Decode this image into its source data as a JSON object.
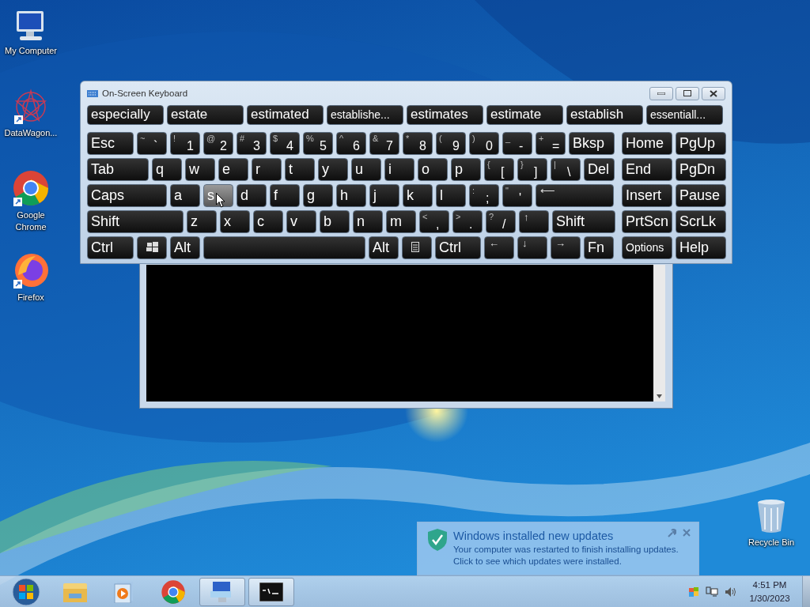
{
  "desktop_icons": [
    {
      "kind": "computer",
      "label": "My Computer"
    },
    {
      "kind": "datawagon",
      "label": "DataWagon..."
    },
    {
      "kind": "chrome",
      "label": "Google Chrome"
    },
    {
      "kind": "firefox",
      "label": "Firefox"
    },
    {
      "kind": "recycle",
      "label": "Recycle Bin"
    }
  ],
  "keyboard": {
    "title": "On-Screen Keyboard",
    "suggestions": [
      "especially",
      "estate",
      "estimated",
      "establishe...",
      "estimates",
      "estimate",
      "establish",
      "essentiall..."
    ],
    "rows": [
      {
        "keys": [
          {
            "kind": "word",
            "label": "Esc",
            "highlighted": false
          },
          {
            "kind": "char",
            "shift": "~",
            "main": "`",
            "highlighted": false
          },
          {
            "kind": "char",
            "shift": "!",
            "main": "1",
            "highlighted": false
          },
          {
            "kind": "char",
            "shift": "@",
            "main": "2",
            "highlighted": false
          },
          {
            "kind": "char",
            "shift": "#",
            "main": "3",
            "highlighted": false
          },
          {
            "kind": "char",
            "shift": "$",
            "main": "4",
            "highlighted": false
          },
          {
            "kind": "char",
            "shift": "%",
            "main": "5",
            "highlighted": false
          },
          {
            "kind": "char",
            "shift": "^",
            "main": "6",
            "highlighted": false
          },
          {
            "kind": "char",
            "shift": "&",
            "main": "7",
            "highlighted": false
          },
          {
            "kind": "char",
            "shift": "*",
            "main": "8",
            "highlighted": false
          },
          {
            "kind": "char",
            "shift": "(",
            "main": "9",
            "highlighted": false
          },
          {
            "kind": "char",
            "shift": ")",
            "main": "0",
            "highlighted": false
          },
          {
            "kind": "char",
            "shift": "_",
            "main": "-",
            "highlighted": false
          },
          {
            "kind": "char",
            "shift": "+",
            "main": "=",
            "highlighted": false
          },
          {
            "kind": "word",
            "label": "Bksp",
            "highlighted": false
          }
        ]
      },
      {
        "keys": [
          {
            "kind": "word",
            "label": "Tab",
            "highlighted": false
          },
          {
            "kind": "word",
            "label": "q",
            "highlighted": false
          },
          {
            "kind": "word",
            "label": "w",
            "highlighted": false
          },
          {
            "kind": "word",
            "label": "e",
            "highlighted": false
          },
          {
            "kind": "word",
            "label": "r",
            "highlighted": false
          },
          {
            "kind": "word",
            "label": "t",
            "highlighted": false
          },
          {
            "kind": "word",
            "label": "y",
            "highlighted": false
          },
          {
            "kind": "word",
            "label": "u",
            "highlighted": false
          },
          {
            "kind": "word",
            "label": "i",
            "highlighted": false
          },
          {
            "kind": "word",
            "label": "o",
            "highlighted": false
          },
          {
            "kind": "word",
            "label": "p",
            "highlighted": false
          },
          {
            "kind": "char",
            "shift": "{",
            "main": "[",
            "highlighted": false
          },
          {
            "kind": "char",
            "shift": "}",
            "main": "]",
            "highlighted": false
          },
          {
            "kind": "char",
            "shift": "|",
            "main": "\\",
            "highlighted": false
          },
          {
            "kind": "word",
            "label": "Del",
            "highlighted": false
          }
        ]
      },
      {
        "keys": [
          {
            "kind": "word",
            "label": "Caps",
            "highlighted": false
          },
          {
            "kind": "word",
            "label": "a",
            "highlighted": false
          },
          {
            "kind": "word",
            "label": "s",
            "highlighted": true
          },
          {
            "kind": "word",
            "label": "d",
            "highlighted": false
          },
          {
            "kind": "word",
            "label": "f",
            "highlighted": false
          },
          {
            "kind": "word",
            "label": "g",
            "highlighted": false
          },
          {
            "kind": "word",
            "label": "h",
            "highlighted": false
          },
          {
            "kind": "word",
            "label": "j",
            "highlighted": false
          },
          {
            "kind": "word",
            "label": "k",
            "highlighted": false
          },
          {
            "kind": "word",
            "label": "l",
            "highlighted": false
          },
          {
            "kind": "char",
            "shift": ":",
            "main": ";",
            "highlighted": false
          },
          {
            "kind": "char",
            "shift": "\"",
            "main": "'",
            "highlighted": false
          },
          {
            "kind": "arrow",
            "label": "⟵",
            "highlighted": false
          }
        ]
      },
      {
        "keys": [
          {
            "kind": "word",
            "label": "Shift",
            "highlighted": false
          },
          {
            "kind": "word",
            "label": "z",
            "highlighted": false
          },
          {
            "kind": "word",
            "label": "x",
            "highlighted": false
          },
          {
            "kind": "word",
            "label": "c",
            "highlighted": false
          },
          {
            "kind": "word",
            "label": "v",
            "highlighted": false
          },
          {
            "kind": "word",
            "label": "b",
            "highlighted": false
          },
          {
            "kind": "word",
            "label": "n",
            "highlighted": false
          },
          {
            "kind": "word",
            "label": "m",
            "highlighted": false
          },
          {
            "kind": "char",
            "shift": "<",
            "main": ",",
            "highlighted": false
          },
          {
            "kind": "char",
            "shift": ">",
            "main": ".",
            "highlighted": false
          },
          {
            "kind": "char",
            "shift": "?",
            "main": "/",
            "highlighted": false
          },
          {
            "kind": "arrow",
            "label": "↑",
            "highlighted": false
          },
          {
            "kind": "word",
            "label": "Shift",
            "highlighted": false
          }
        ]
      },
      {
        "keys": [
          {
            "kind": "word",
            "label": "Ctrl",
            "highlighted": false
          },
          {
            "kind": "windows",
            "highlighted": false
          },
          {
            "kind": "word",
            "label": "Alt",
            "highlighted": false
          },
          {
            "kind": "space",
            "highlighted": false
          },
          {
            "kind": "word",
            "label": "Alt",
            "highlighted": false
          },
          {
            "kind": "menu",
            "highlighted": false
          },
          {
            "kind": "word",
            "label": "Ctrl",
            "highlighted": false
          },
          {
            "kind": "arrow",
            "label": "←",
            "highlighted": false
          },
          {
            "kind": "arrow",
            "label": "↓",
            "highlighted": false
          },
          {
            "kind": "arrow",
            "label": "→",
            "highlighted": false
          },
          {
            "kind": "word",
            "label": "Fn",
            "highlighted": false
          }
        ]
      }
    ],
    "nav_keys": [
      {
        "label": "Home",
        "small": false
      },
      {
        "label": "PgUp",
        "small": false
      },
      {
        "label": "End",
        "small": false
      },
      {
        "label": "PgDn",
        "small": false
      },
      {
        "label": "Insert",
        "small": false
      },
      {
        "label": "Pause",
        "small": false
      },
      {
        "label": "PrtScn",
        "small": false
      },
      {
        "label": "ScrLk",
        "small": false
      },
      {
        "label": "Options",
        "small": true
      },
      {
        "label": "Help",
        "small": false
      }
    ]
  },
  "notification": {
    "title": "Windows installed new updates",
    "body": "Your computer was restarted to finish installing updates. Click to see which updates were installed."
  },
  "taskbar": {
    "items": [
      {
        "kind": "start",
        "active": false
      },
      {
        "kind": "explorer",
        "active": false
      },
      {
        "kind": "media",
        "active": false
      },
      {
        "kind": "chrome",
        "active": false
      },
      {
        "kind": "keyboard",
        "active": true
      },
      {
        "kind": "console",
        "active": true
      }
    ],
    "time": "4:51 PM",
    "date": "1/30/2023"
  }
}
